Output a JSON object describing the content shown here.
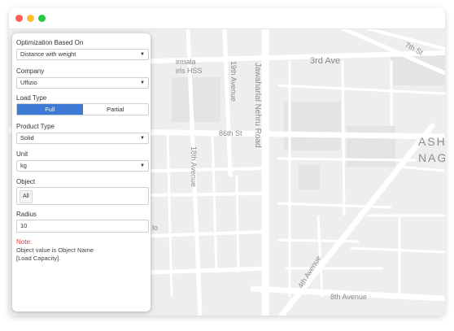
{
  "window": {
    "controls": {
      "close_color": "#ff5f57",
      "minimize_color": "#ffbd2e",
      "maximize_color": "#28c840"
    }
  },
  "map": {
    "labels": {
      "nirmala_school": "Nirmala Girls HSS",
      "nirmala_l1": "irmala",
      "nirmala_l2": "irls HSS",
      "avenue_19": "19th Avenue",
      "avenue_18": "18th Avenue",
      "street_86": "86th St",
      "jln_road": "Jawaharlal Nehru Road",
      "avenue_3rd": "3rd Ave",
      "street_7th": "7th St",
      "ash_nag_1": "ASH",
      "ash_nag_2": "NAG",
      "avenue_4th": "4th Avenue",
      "avenue_8th": "8th Avenue",
      "partial_lo": "lo"
    }
  },
  "panel": {
    "optimization": {
      "label": "Optimization Based On",
      "value": "Distance with weight"
    },
    "company": {
      "label": "Company",
      "value": "Uffizio"
    },
    "load_type": {
      "label": "Load Type",
      "options": [
        "Full",
        "Partial"
      ],
      "selected": "Full"
    },
    "product_type": {
      "label": "Product Type",
      "value": "Solid"
    },
    "unit": {
      "label": "Unit",
      "value": "kg"
    },
    "object": {
      "label": "Object",
      "chip": "All"
    },
    "radius": {
      "label": "Radius",
      "value": "10"
    },
    "note": {
      "title": "Note:",
      "line1": "Object value is Object Name",
      "line2": "[Load Capacity]."
    }
  },
  "colors": {
    "accent": "#3d7ad6",
    "note": "#e03a3a",
    "map_bg": "#eeeeee",
    "road": "#ffffff"
  }
}
